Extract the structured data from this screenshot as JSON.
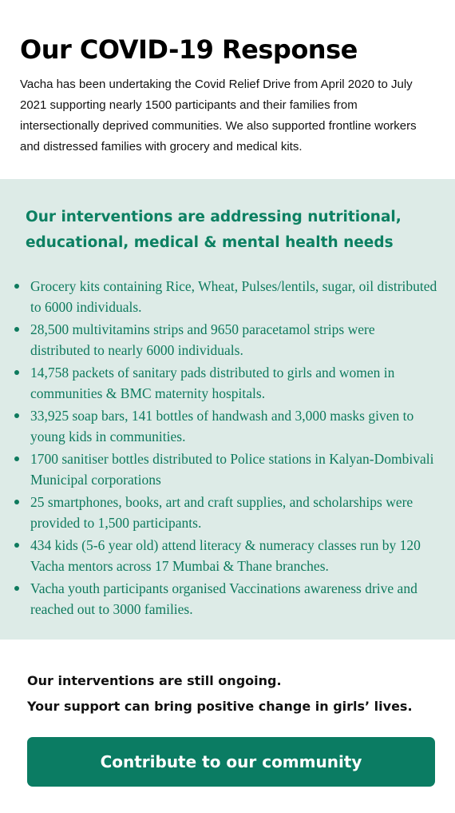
{
  "hero": {
    "title": "Our COVID-19 Response",
    "description": "Vacha has been undertaking the Covid Relief Drive from April 2020 to July 2021 supporting nearly 1500 participants and their families from intersectionally deprived communities. We also supported frontline workers and distressed families with grocery and medical kits."
  },
  "interventions": {
    "heading": "Our interventions are addressing nutritional, educational, medical & mental health needs",
    "items": [
      "Grocery kits containing Rice, Wheat, Pulses/lentils, sugar, oil distributed to 6000 individuals.",
      "28,500 multivitamins strips and 9650 paracetamol strips were distributed to nearly 6000 individuals.",
      "14,758 packets of sanitary pads distributed to girls and women in communities & BMC maternity hospitals.",
      "33,925 soap bars, 141 bottles of handwash and 3,000 masks given to young kids in communities.",
      "1700 sanitiser bottles distributed to Police stations in Kalyan-Dombivali Municipal corporations",
      "25 smartphones, books, art and craft supplies, and scholarships were provided to 1,500  participants.",
      "434 kids (5-6 year old) attend literacy & numeracy classes run by 120 Vacha mentors across 17 Mumbai & Thane branches.",
      "Vacha youth participants organised Vaccinations awareness drive and reached out to 3000 families."
    ]
  },
  "cta": {
    "line1": "Our interventions are still ongoing.",
    "line2": "Your support can bring positive change in girls’ lives.",
    "button_label": "Contribute to our community"
  },
  "colors": {
    "accent": "#0b7c63",
    "panel_background": "#ddebe7",
    "accent_text": "#0e7a5e"
  }
}
